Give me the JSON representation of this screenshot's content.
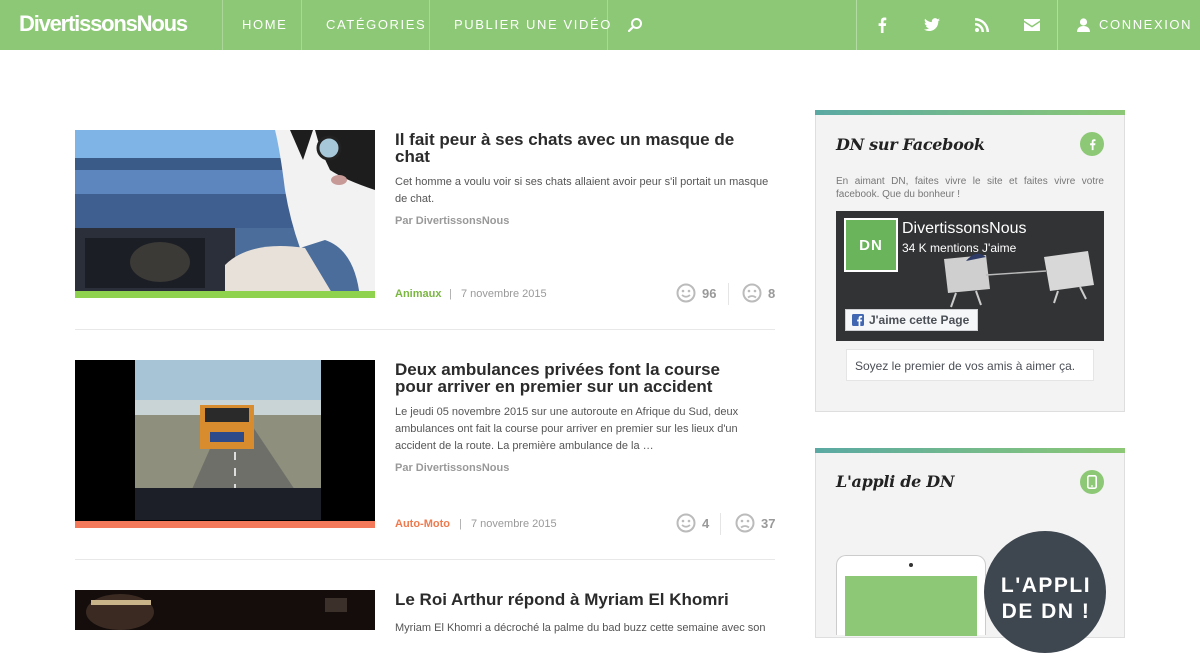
{
  "header": {
    "logo": "DivertissonsNous",
    "nav": [
      {
        "label": "HOME"
      },
      {
        "label": "CATÉGORIES"
      },
      {
        "label": "PUBLIER UNE VIDÉO"
      }
    ],
    "search_icon": "search-icon",
    "social": [
      "facebook-icon",
      "twitter-icon",
      "rss-icon",
      "email-icon"
    ],
    "login_label": "CONNEXION",
    "login_icon": "user-icon"
  },
  "colors": {
    "brand_green": "#8cc875",
    "cat_animaux": "#7ab640",
    "cat_automoto": "#ee7a4e"
  },
  "articles": [
    {
      "title": "Il fait peur à ses chats avec un masque de chat",
      "excerpt": "Cet homme a voulu voir si ses chats allaient avoir peur s'il portait un masque de chat.",
      "author": "Par DivertissonsNous",
      "category": "Animaux",
      "date": "7 novembre 2015",
      "likes": "96",
      "dislikes": "8"
    },
    {
      "title": "Deux ambulances privées font la course pour arriver en premier sur un accident",
      "excerpt": "Le jeudi 05 novembre 2015 sur une autoroute en Afrique du Sud, deux ambulances ont fait la course pour arriver en premier sur les lieux d'un accident de la route. La première ambulance de la …",
      "author": "Par DivertissonsNous",
      "category": "Auto-Moto",
      "date": "7 novembre 2015",
      "likes": "4",
      "dislikes": "37"
    },
    {
      "title": "Le Roi Arthur répond à Myriam El Khomri",
      "excerpt": "Myriam El Khomri a décroché la palme du bad buzz cette semaine avec son"
    }
  ],
  "sidebar": {
    "facebook": {
      "title": "DN sur Facebook",
      "icon": "facebook-icon",
      "description": "En aimant DN, faites vivre le site et faites vivre votre facebook. Que du bonheur !",
      "page_logo": "DN",
      "page_name": "DivertissonsNous",
      "page_likes": "34 K mentions J'aime",
      "like_button": "J'aime cette Page",
      "friends_text": "Soyez le premier de vos amis à aimer ça."
    },
    "app": {
      "title": "L'appli de DN",
      "icon": "mobile-icon",
      "promo_text": "L'APPLI DE DN !"
    }
  }
}
